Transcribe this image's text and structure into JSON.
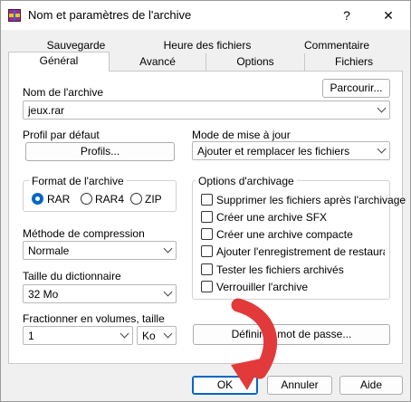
{
  "window": {
    "title": "Nom et paramètres de l'archive",
    "help": "?",
    "close": "✕"
  },
  "tabs": {
    "back": [
      "Sauvegarde",
      "Heure des fichiers",
      "Commentaire"
    ],
    "front": [
      "Général",
      "Avancé",
      "Options",
      "Fichiers"
    ],
    "active": "Général"
  },
  "archive_name": {
    "label": "Nom de l'archive",
    "browse_button": "Parcourir...",
    "value": "jeux.rar"
  },
  "default_profile": {
    "label": "Profil par défaut",
    "button": "Profils..."
  },
  "update_mode": {
    "label": "Mode de mise à jour",
    "value": "Ajouter et remplacer les fichiers"
  },
  "archive_format": {
    "title": "Format de l'archive",
    "options": [
      "RAR",
      "RAR4",
      "ZIP"
    ],
    "selected": "RAR"
  },
  "archiving_options": {
    "title": "Options d'archivage",
    "items": [
      {
        "label": "Supprimer les fichiers après l'archivage",
        "checked": false
      },
      {
        "label": "Créer une archive SFX",
        "checked": false
      },
      {
        "label": "Créer une archive compacte",
        "checked": false
      },
      {
        "label": "Ajouter l'enregistrement de restauratio",
        "checked": false
      },
      {
        "label": "Tester les fichiers archivés",
        "checked": false
      },
      {
        "label": "Verrouiller l'archive",
        "checked": false
      }
    ]
  },
  "compression_method": {
    "label": "Méthode de compression",
    "value": "Normale"
  },
  "dictionary_size": {
    "label": "Taille du dictionnaire",
    "value": "32 Mo"
  },
  "split_volumes": {
    "label": "Fractionner en volumes, taille",
    "value": "1",
    "unit": "Ko"
  },
  "password_button": "Définir le mot de passe...",
  "footer": {
    "ok": "OK",
    "cancel": "Annuler",
    "help": "Aide"
  },
  "colors": {
    "accent": "#0067c0",
    "pointer": "#e23a3a"
  }
}
